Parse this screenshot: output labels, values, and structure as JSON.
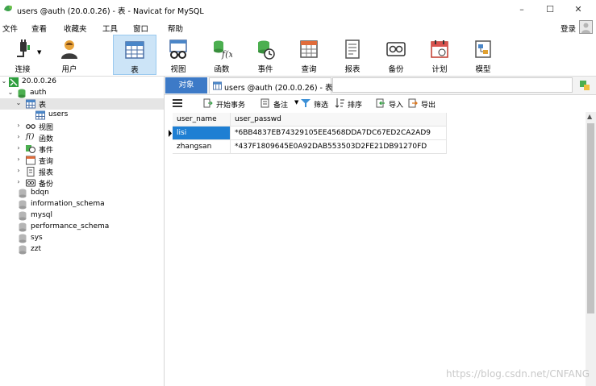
{
  "window": {
    "title": "users @auth (20.0.0.26) - 表 - Navicat for MySQL",
    "controls": {
      "minimize": "–",
      "maximize": "☐",
      "close": "✕"
    }
  },
  "menubar": {
    "items": [
      "文件",
      "查看",
      "收藏夹",
      "工具",
      "窗口",
      "帮助"
    ],
    "login": "登录"
  },
  "toolbar": {
    "items": [
      {
        "label": "连接",
        "icon": "plug-icon"
      },
      {
        "label": "用户",
        "icon": "user-icon"
      },
      {
        "label": "表",
        "icon": "table-icon",
        "active": true
      },
      {
        "label": "视图",
        "icon": "view-icon"
      },
      {
        "label": "函数",
        "icon": "function-icon"
      },
      {
        "label": "事件",
        "icon": "event-icon"
      },
      {
        "label": "查询",
        "icon": "query-icon"
      },
      {
        "label": "报表",
        "icon": "report-icon"
      },
      {
        "label": "备份",
        "icon": "backup-icon"
      },
      {
        "label": "计划",
        "icon": "schedule-icon"
      },
      {
        "label": "模型",
        "icon": "model-icon"
      }
    ]
  },
  "nav": {
    "connection": "20.0.0.26",
    "database": "auth",
    "tables_label": "表",
    "table_users": "users",
    "views": "视图",
    "functions": "函数",
    "events": "事件",
    "queries": "查询",
    "reports": "报表",
    "backups": "备份",
    "databases": [
      "bdqn",
      "information_schema",
      "mysql",
      "performance_schema",
      "sys",
      "zzt"
    ]
  },
  "tabs": {
    "objects": "对象",
    "active": "users @auth (20.0.0.26) - 表"
  },
  "subtoolbar": {
    "begin_transaction": "开始事务",
    "note": "备注",
    "filter": "筛选",
    "sort": "排序",
    "import": "导入",
    "export": "导出"
  },
  "grid": {
    "columns": [
      "user_name",
      "user_passwd"
    ],
    "rows": [
      [
        "lisi",
        "*6BB4837EB74329105EE4568DDA7DC67ED2CA2AD9"
      ],
      [
        "zhangsan",
        "*437F1809645E0A92DAB553503D2FE21DB91270FD"
      ]
    ]
  },
  "watermark": "https://blog.csdn.net/CNFANG",
  "colors": {
    "accent": "#3d7ac7",
    "selection": "#1e7fd3",
    "active_tool": "#cce4f7"
  }
}
